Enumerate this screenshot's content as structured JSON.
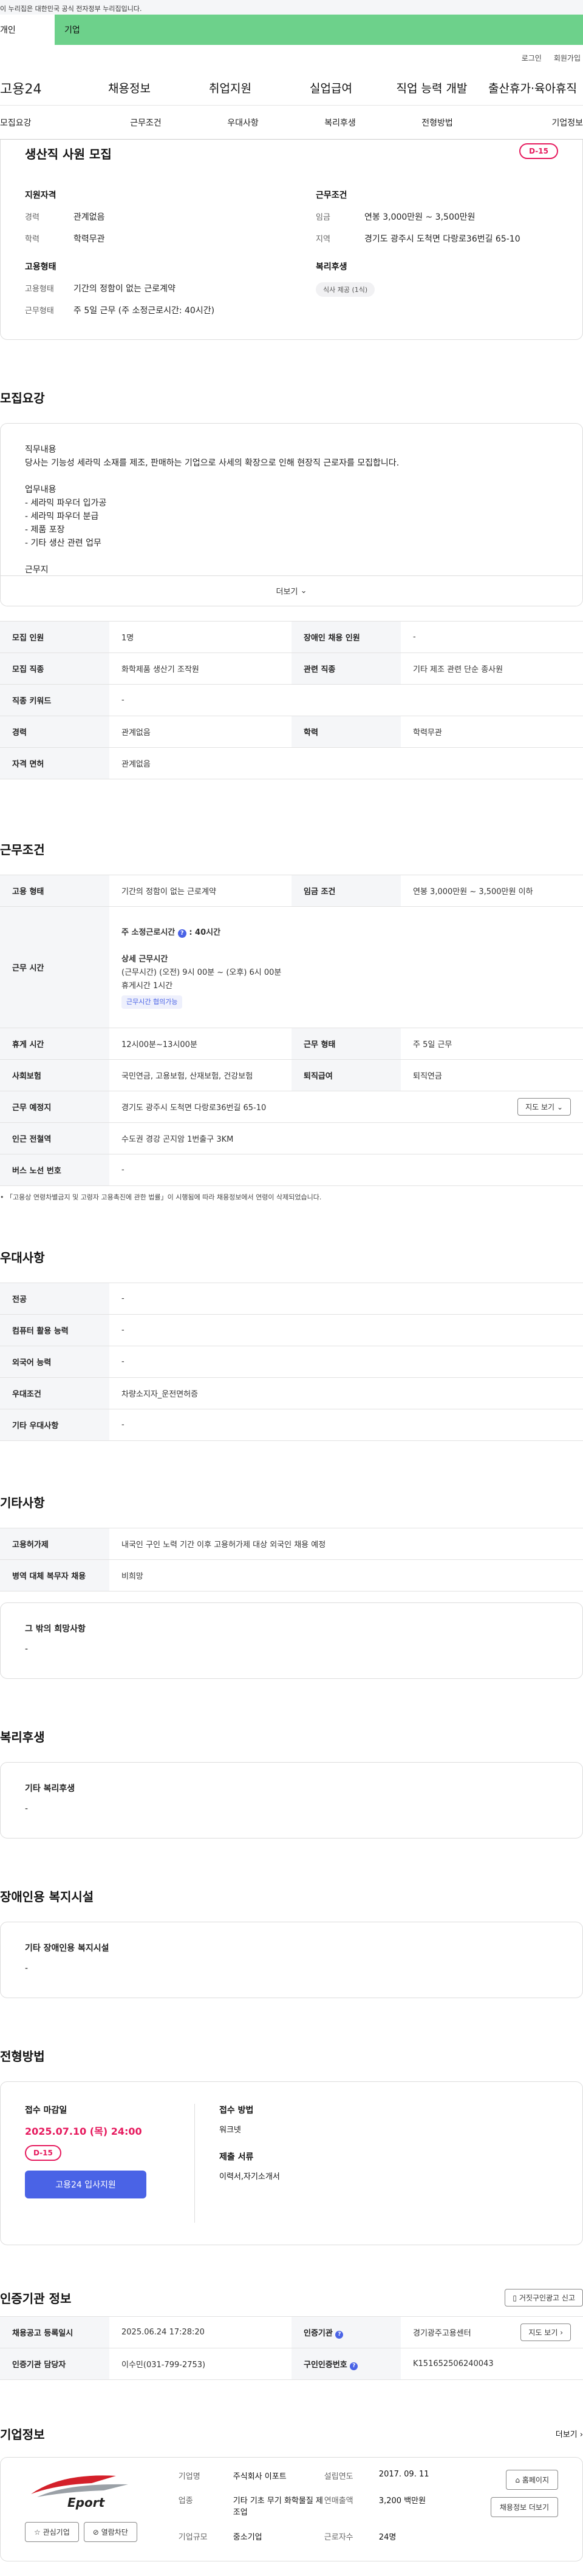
{
  "gov_notice": "이 누리집은 대한민국 공식 전자정부 누리집입니다.",
  "user_types": [
    "개인",
    "기업"
  ],
  "util": [
    "로그인",
    "회원가입"
  ],
  "site": {
    "logo": "고용24"
  },
  "gnb": [
    "채용정보",
    "취업지원",
    "실업급여",
    "직업 능력 개발",
    "출산휴가·육아휴직"
  ],
  "tabs": [
    "모집요강",
    "근무조건",
    "우대사항",
    "복리후생",
    "전형방법",
    "기업정보"
  ],
  "summary": {
    "title": "생산직 사원 모집",
    "dday": "D-15",
    "qual": {
      "heading": "지원자격",
      "rows": [
        {
          "k": "경력",
          "v": "관계없음"
        },
        {
          "k": "학력",
          "v": "학력무관"
        }
      ]
    },
    "emp": {
      "heading": "고용형태",
      "rows": [
        {
          "k": "고용형태",
          "v": "기간의 정함이 없는 근로계약"
        },
        {
          "k": "근무형태",
          "v": "주 5일 근무 (주 소정근로시간: 40시간)"
        }
      ]
    },
    "cond": {
      "heading": "근무조건",
      "rows": [
        {
          "k": "임금",
          "v": "연봉 3,000만원 ~ 3,500만원"
        },
        {
          "k": "지역",
          "v": "경기도 광주시 도척면 다랑로36번길 65-10"
        }
      ]
    },
    "welfare": {
      "heading": "복리후생",
      "chip": "식사 제공 (1식)"
    }
  },
  "recruit": {
    "title": "모집요강",
    "desc": [
      "직무내용",
      "당사는 기능성 세라믹 소재를 제조, 판매하는 기업으로 사세의 확장으로 인해 현장직 근로자를 모집합니다.",
      "",
      "업무내용",
      "- 세라믹 파우더 입가공",
      "- 세라믹 파우더 분급",
      "- 제품 포장",
      "- 기타 생산 관련 업무",
      "",
      "근무지"
    ],
    "more": "더보기",
    "table": [
      [
        "모집 인원",
        "1명",
        "장애인 채용 인원",
        "-"
      ],
      [
        "모집 직종",
        "화학제품 생산기 조작원",
        "관련 직종",
        "기타 제조 관련 단순 종사원"
      ],
      [
        "직종 키워드",
        "-"
      ],
      [
        "경력",
        "관계없음",
        "학력",
        "학력무관"
      ],
      [
        "자격 면허",
        "관계없음"
      ]
    ]
  },
  "work": {
    "title": "근무조건",
    "r1": [
      "고용 형태",
      "기간의 정함이 없는 근로계약",
      "임금 조건",
      "연봉 3,000만원 ~ 3,500만원 이하"
    ],
    "hours": {
      "k": "근무 시간",
      "week": "주 소정근로시간",
      "week_val": ": 40시간",
      "detail_title": "상세 근무시간",
      "detail": "(근무시간) (오전) 9시 00분 ~ (오후) 6시 00분",
      "rest": "휴게시간 1시간",
      "tag": "근무시간 협의가능"
    },
    "rows": [
      [
        "휴게 시간",
        "12시00분~13시00분",
        "근무 형태",
        "주 5일 근무"
      ],
      [
        "사회보험",
        "국민연금, 고용보험, 산재보험, 건강보험",
        "퇴직급여",
        "퇴직연금"
      ]
    ],
    "place": {
      "k": "근무 예정지",
      "v": "경기도 광주시 도척면 다랑로36번길 65-10",
      "btn": "지도 보기"
    },
    "rows2": [
      [
        "인근 전철역",
        "수도권 경강 곤지암 1번출구 3KM"
      ],
      [
        "버스 노선 번호",
        "-"
      ]
    ],
    "note": "「고용상 연령차별금지 및 고령자 고용촉진에 관한 법률」이 시행됨에 따라 채용정보에서 연령이 삭제되었습니다."
  },
  "pref": {
    "title": "우대사항",
    "rows": [
      [
        "전공",
        "-"
      ],
      [
        "컴퓨터 활용 능력",
        "-"
      ],
      [
        "외국어 능력",
        "-"
      ],
      [
        "우대조건",
        "차량소지자_운전면허증"
      ],
      [
        "기타 우대사항",
        "-"
      ]
    ]
  },
  "etc": {
    "title": "기타사항",
    "rows": [
      [
        "고용허가제",
        "내국인 구인 노력 기간 이후 고용허가제 대상 외국인 채용 예정"
      ],
      [
        "병역 대체 복무자 채용",
        "비희망"
      ]
    ],
    "box_title": "그 밖의 희망사항",
    "box_val": "-"
  },
  "welfare": {
    "title": "복리후생",
    "box_title": "기타 복리후생",
    "box_val": "-"
  },
  "disab": {
    "title": "장애인용 복지시설",
    "box_title": "기타 장애인용 복지시설",
    "box_val": "-"
  },
  "process": {
    "title": "전형방법",
    "deadline_lbl": "접수 마감일",
    "deadline": "2025.07.10 (목) 24:00",
    "dday": "D-15",
    "apply_btn": "고용24 입사지원",
    "method_lbl": "접수 방법",
    "method": "워크넷",
    "docs_lbl": "제출 서류",
    "docs": "이력서,자기소개서"
  },
  "cert": {
    "title": "인증기관 정보",
    "btn": "거짓구인광고 신고",
    "rows": [
      [
        "채용공고 등록일시",
        "2025.06.24 17:28:20",
        "인증기관",
        "경기광주고용센터"
      ],
      [
        "인증기관 담당자",
        "이수민(031-799-2753)",
        "구인인증번호",
        "K151652506240043"
      ]
    ],
    "map_btn": "지도 보기"
  },
  "company": {
    "title": "기업정보",
    "more": "더보기",
    "logo_text": "Eport",
    "interest": "관심기업",
    "block": "열람차단",
    "grid": [
      [
        "기업명",
        "주식회사 이포트",
        "설립연도",
        "2017. 09. 11"
      ],
      [
        "업종",
        "기타 기초 무기 화학물질 제조업",
        "연매출액",
        "3,200 백만원"
      ],
      [
        "기업규모",
        "중소기업",
        "근로자수",
        "24명"
      ]
    ],
    "btns": [
      "홈페이지",
      "채용정보 더보기"
    ]
  }
}
